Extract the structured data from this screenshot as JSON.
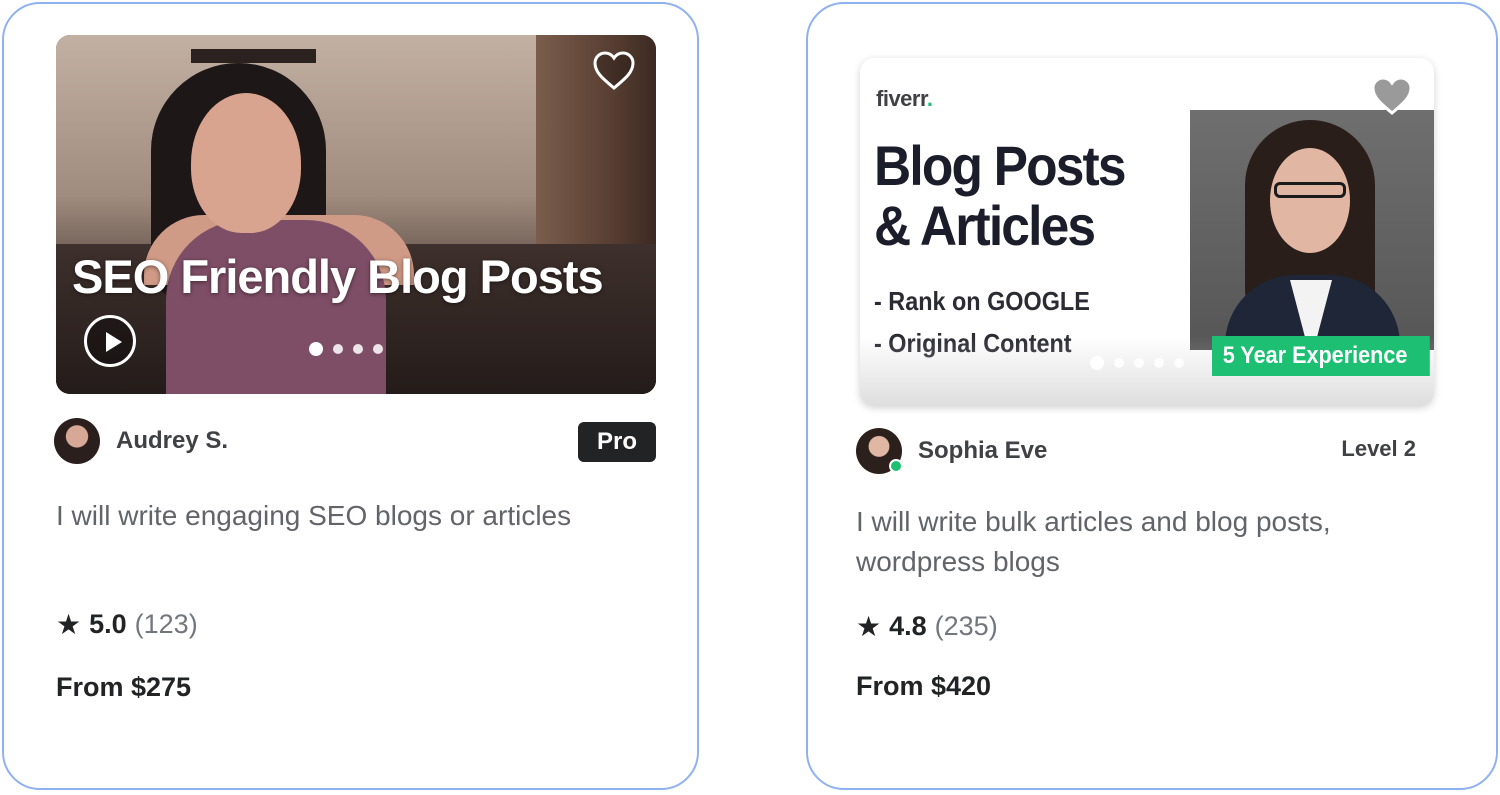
{
  "colors": {
    "card_border": "#8fb1f2",
    "fiverr_green": "#1dbf73",
    "pro_badge_bg": "#222325"
  },
  "gigs": [
    {
      "thumbnail": {
        "headline": "SEO Friendly Blog Posts",
        "icons": [
          "play-icon",
          "heart-icon"
        ],
        "carousel_dots": 4
      },
      "seller": {
        "name": "Audrey S.",
        "badge": "Pro"
      },
      "title": "I will write engaging SEO blogs or articles",
      "rating": {
        "score": "5.0",
        "count": "(123)"
      },
      "price": "From $275"
    },
    {
      "thumbnail": {
        "logo": "fiverr",
        "logo_dot": ".",
        "headline": "Blog Posts & Articles",
        "bullets": [
          "- Rank on GOOGLE",
          "- Original Content"
        ],
        "badge": "5 Year Experience",
        "icons": [
          "heart-icon"
        ],
        "carousel_dots": 5
      },
      "seller": {
        "name": "Sophia Eve",
        "level": "Level 2",
        "online": true
      },
      "title": "I will write bulk articles and blog posts, wordpress blogs",
      "rating": {
        "score": "4.8",
        "count": "(235)"
      },
      "price": "From $420"
    }
  ]
}
